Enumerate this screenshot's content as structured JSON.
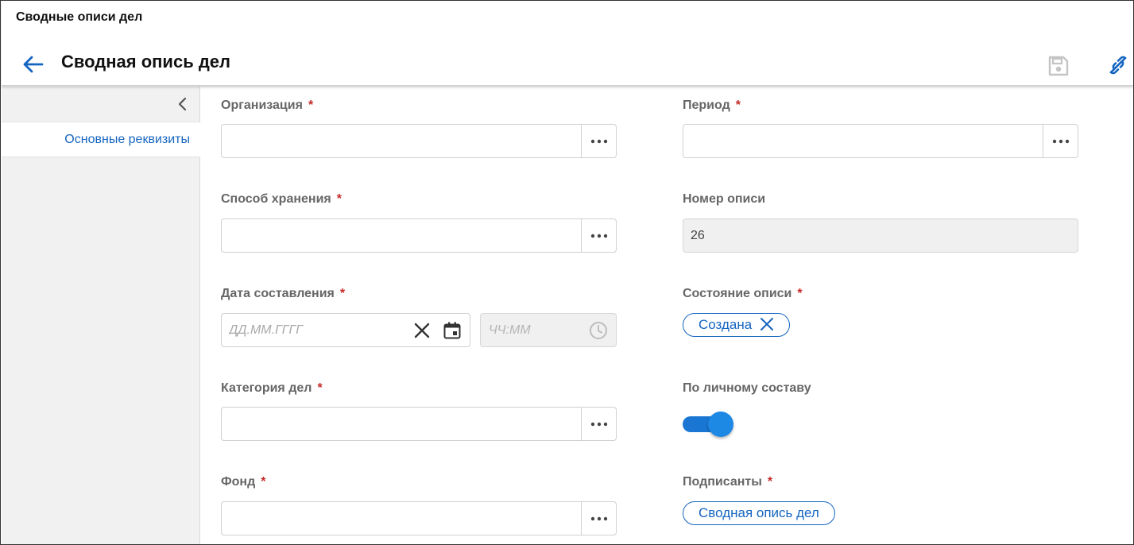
{
  "header": {
    "app_title": "Сводные описи дел",
    "page_title": "Сводная опись дел"
  },
  "sidebar": {
    "items": [
      {
        "label": "Основные реквизиты"
      }
    ]
  },
  "form": {
    "organization": {
      "label": "Организация",
      "required": "*",
      "value": ""
    },
    "period": {
      "label": "Период",
      "required": "*",
      "value": ""
    },
    "storage_method": {
      "label": "Способ хранения",
      "required": "*",
      "value": ""
    },
    "inventory_number": {
      "label": "Номер описи",
      "value": "26"
    },
    "compile_date": {
      "label": "Дата составления",
      "required": "*",
      "date_placeholder": "ДД.ММ.ГГГГ",
      "time_placeholder": "ЧЧ:ММ"
    },
    "inventory_state": {
      "label": "Состояние описи",
      "required": "*",
      "chip": "Создана"
    },
    "case_category": {
      "label": "Категория дел",
      "required": "*",
      "value": ""
    },
    "personnel": {
      "label": "По личному составу",
      "enabled": true
    },
    "fund": {
      "label": "Фонд",
      "required": "*",
      "value": ""
    },
    "signers": {
      "label": "Подписанты",
      "required": "*",
      "chip": "Сводная опись дел"
    }
  },
  "icons": {
    "back": "arrow-left-icon",
    "save": "save-icon",
    "link": "link-icon",
    "collapse": "chevron-left-icon",
    "more": "more-horizontal-icon",
    "clear": "close-icon",
    "calendar": "calendar-icon",
    "clock": "clock-icon"
  },
  "colors": {
    "accent": "#1565c0",
    "required": "#c62828",
    "toggle": "#1976d2",
    "sidebar_bg": "#f1f1f1"
  }
}
